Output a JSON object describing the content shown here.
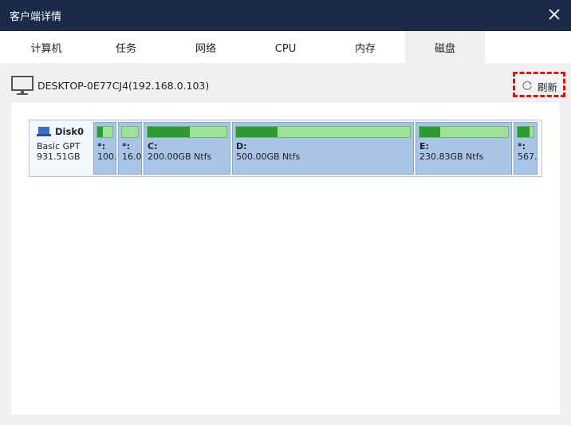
{
  "window": {
    "title": "客户端详情"
  },
  "tabs": [
    {
      "label": "计算机"
    },
    {
      "label": "任务"
    },
    {
      "label": "网络"
    },
    {
      "label": "CPU"
    },
    {
      "label": "内存"
    },
    {
      "label": "磁盘",
      "active": true
    }
  ],
  "host": {
    "name": "DESKTOP-0E77CJ4(192.168.0.103)"
  },
  "toolbar": {
    "refresh_label": "刷新"
  },
  "disk": {
    "name": "Disk0",
    "type": "Basic GPT",
    "size": "931.51GB",
    "partitions": [
      {
        "label": "*:",
        "info": "100.",
        "used_fraction": 0.35
      },
      {
        "label": "*:",
        "info": "16.0",
        "used_fraction": 0.0
      },
      {
        "label": "C:",
        "info": "200.00GB Ntfs",
        "used_fraction": 0.54
      },
      {
        "label": "D:",
        "info": "500.00GB Ntfs",
        "used_fraction": 0.24
      },
      {
        "label": "E:",
        "info": "230.83GB Ntfs",
        "used_fraction": 0.23
      },
      {
        "label": "*:",
        "info": "567.",
        "used_fraction": 0.75
      }
    ]
  },
  "colors": {
    "titlebar": "#1b2a4a",
    "partition_bg": "#a8c4e6",
    "used_fill": "#2f9a33",
    "free_fill": "#9ee29a",
    "highlight_border": "#e01010"
  },
  "icons": {
    "close": "close-icon",
    "monitor": "monitor-icon",
    "refresh": "refresh-icon",
    "disk": "disk-icon"
  }
}
